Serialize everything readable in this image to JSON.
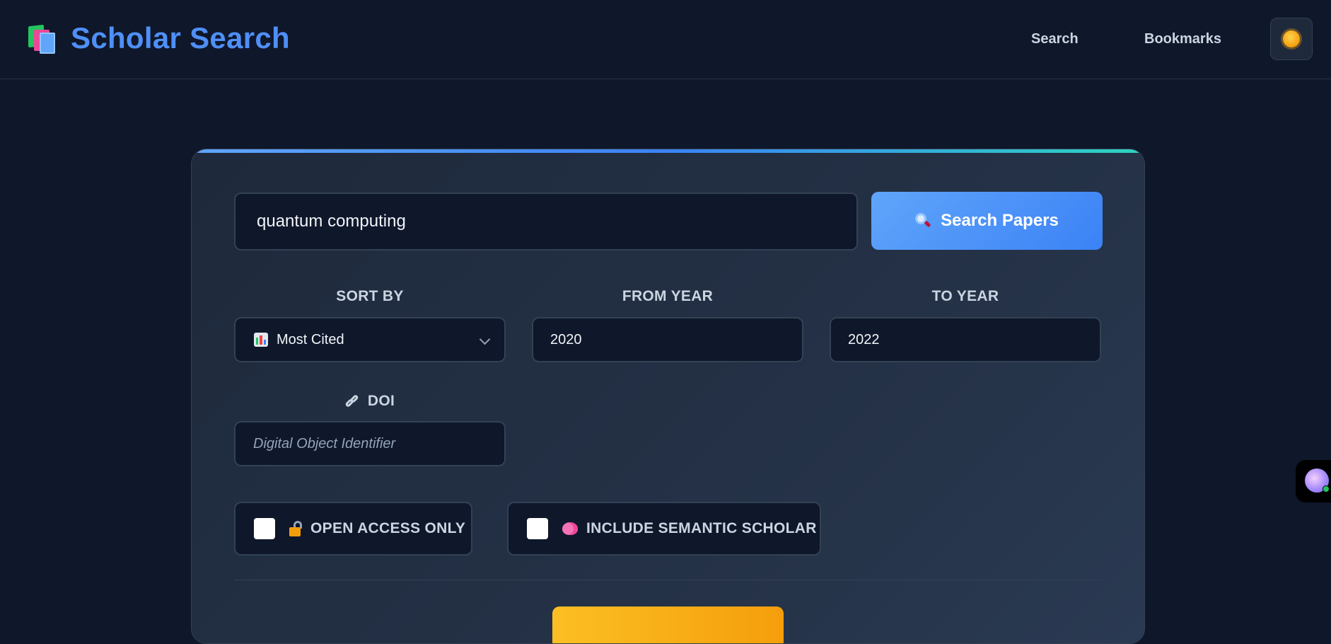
{
  "header": {
    "title": "Scholar Search",
    "nav": [
      {
        "label": "Search"
      },
      {
        "label": "Bookmarks"
      }
    ],
    "theme_icon": "sun-icon"
  },
  "search": {
    "query": "quantum computing",
    "button_label": "Search Papers"
  },
  "filters": {
    "sort_label": "SORT BY",
    "sort_value": "Most Cited",
    "from_label": "FROM YEAR",
    "from_value": "2020",
    "to_label": "TO YEAR",
    "to_value": "2022",
    "doi_label": "DOI",
    "doi_placeholder": "Digital Object Identifier"
  },
  "options": {
    "open_access_label": "OPEN ACCESS ONLY",
    "open_access_checked": false,
    "semantic_label": "INCLUDE SEMANTIC SCHOLAR",
    "semantic_checked": false
  },
  "colors": {
    "background": "#0f172a",
    "brand": "#4f8ff7",
    "primary_button": "#3b82f6",
    "secondary_button": "#f59e0b"
  }
}
